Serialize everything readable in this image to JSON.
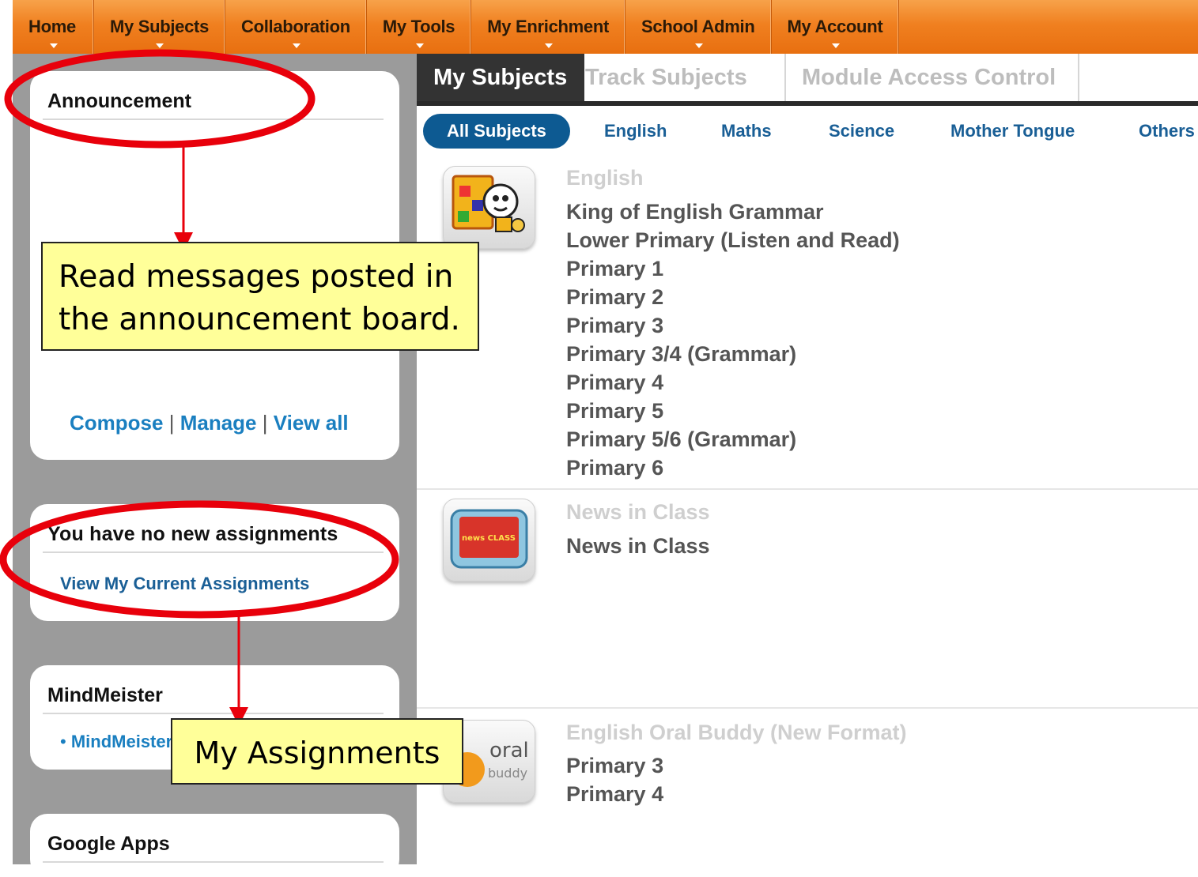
{
  "nav": {
    "items": [
      {
        "label": "Home"
      },
      {
        "label": "My Subjects"
      },
      {
        "label": "Collaboration"
      },
      {
        "label": "My Tools"
      },
      {
        "label": "My Enrichment"
      },
      {
        "label": "School Admin"
      },
      {
        "label": "My Account"
      }
    ]
  },
  "sidebar": {
    "announcement": {
      "title": "Announcement",
      "compose": "Compose",
      "manage": "Manage",
      "view_all": "View all",
      "sep": "|"
    },
    "assignments": {
      "title": "You have no new assignments",
      "link": "View My Current Assignments"
    },
    "mindmeister": {
      "title": "MindMeister",
      "item": "MindMeister"
    },
    "google_apps": {
      "title": "Google Apps"
    }
  },
  "main": {
    "tabs": [
      {
        "label": "My Subjects"
      },
      {
        "label": "Track Subjects"
      },
      {
        "label": "Module Access Control"
      }
    ],
    "subtabs": [
      {
        "label": "All Subjects"
      },
      {
        "label": "English"
      },
      {
        "label": "Maths"
      },
      {
        "label": "Science"
      },
      {
        "label": "Mother Tongue"
      },
      {
        "label": "Others"
      }
    ],
    "subjects": [
      {
        "title": "English",
        "items": [
          "King of English Grammar",
          "Lower Primary (Listen and Read)",
          "Primary 1",
          "Primary 2",
          "Primary 3",
          "Primary 3/4 (Grammar)",
          "Primary 4",
          "Primary 5",
          "Primary 5/6 (Grammar)",
          "Primary 6"
        ]
      },
      {
        "title": "News in Class",
        "items": [
          "News in Class"
        ],
        "icon_text": "news CLASS"
      },
      {
        "title": "English Oral Buddy (New Format)",
        "items": [
          "Primary 3",
          "Primary 4"
        ],
        "icon_text_1": "oral",
        "icon_text_2": "buddy"
      }
    ]
  },
  "annotations": {
    "callout1_line1": "Read messages posted in",
    "callout1_line2": "the announcement board.",
    "callout2": "My Assignments",
    "color": "#e8000b"
  }
}
